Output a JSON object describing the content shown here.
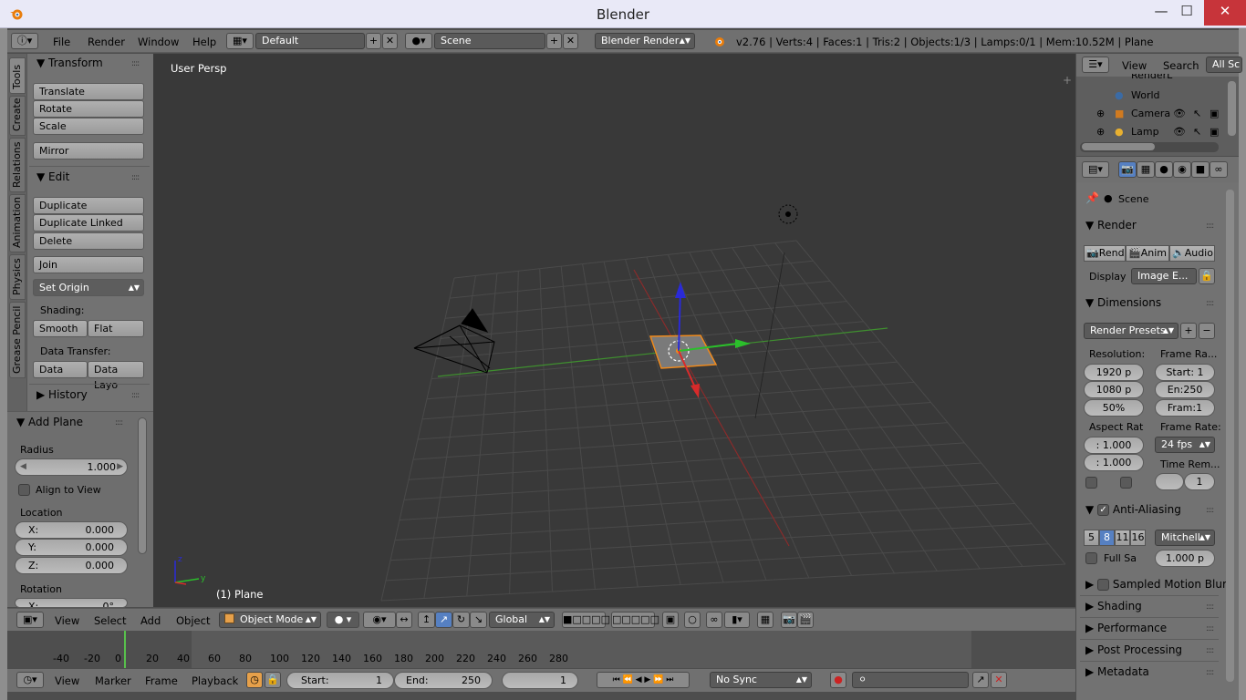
{
  "window": {
    "title": "Blender",
    "minimize": "—",
    "maximize": "☐",
    "close": "✕"
  },
  "info_bar": {
    "menus": [
      "File",
      "Render",
      "Window",
      "Help"
    ],
    "layout": "Default",
    "scene": "Scene",
    "engine": "Blender Render",
    "stats": "v2.76 | Verts:4 | Faces:1 | Tris:2 | Objects:1/3 | Lamps:0/1 | Mem:10.52M | Plane"
  },
  "toolshelf": {
    "tabs": [
      "Tools",
      "Create",
      "Relations",
      "Animation",
      "Physics",
      "Grease Pencil"
    ],
    "transform": {
      "title": "Transform",
      "buttons": [
        "Translate",
        "Rotate",
        "Scale",
        "Mirror"
      ]
    },
    "edit": {
      "title": "Edit",
      "buttons": [
        "Duplicate",
        "Duplicate Linked",
        "Delete",
        "Join"
      ],
      "set_origin": "Set Origin"
    },
    "shading": {
      "label": "Shading:",
      "smooth": "Smooth",
      "flat": "Flat"
    },
    "data_transfer": {
      "label": "Data Transfer:",
      "data": "Data",
      "data_layo": "Data Layo"
    },
    "history": "History"
  },
  "operator": {
    "title": "Add Plane",
    "radius_label": "Radius",
    "radius_value": "1.000",
    "align_label": "Align to View",
    "location_label": "Location",
    "x_label": "X:",
    "x_value": "0.000",
    "y_label": "Y:",
    "y_value": "0.000",
    "z_label": "Z:",
    "z_value": "0.000",
    "rotation_label": "Rotation",
    "rot_x_label": "X:",
    "rot_x_value": "0°"
  },
  "viewport": {
    "view_name": "User Persp",
    "object_name": "(1) Plane"
  },
  "viewport_header": {
    "menus": [
      "View",
      "Select",
      "Add",
      "Object"
    ],
    "mode": "Object Mode",
    "orientation": "Global"
  },
  "timeline": {
    "ruler": [
      "-40",
      "-20",
      "0",
      "20",
      "40",
      "60",
      "80",
      "100",
      "120",
      "140",
      "160",
      "180",
      "200",
      "220",
      "240",
      "260",
      "280"
    ],
    "current_frame_fraction": 0.0,
    "menus": [
      "View",
      "Marker",
      "Frame",
      "Playback"
    ],
    "start_label": "Start:",
    "start_value": "1",
    "end_label": "End:",
    "end_value": "250",
    "current": "1",
    "sync": "No Sync"
  },
  "outliner": {
    "menus": [
      "View",
      "Search"
    ],
    "scenes_button": "All Sc",
    "rows": [
      "RenderL",
      "World",
      "Camera",
      "Lamp"
    ]
  },
  "properties": {
    "scene": "Scene",
    "render": {
      "title": "Render",
      "rend": "Rend",
      "anim": "Anim",
      "audio": "Audio",
      "display_label": "Display",
      "display_value": "Image E..."
    },
    "dimensions": {
      "title": "Dimensions",
      "presets": "Render Presets",
      "resolution_label": "Resolution:",
      "res_x": "1920 p",
      "res_y": "1080 p",
      "res_pct": "50%",
      "frame_range_label": "Frame Ra...",
      "start": "Start: 1",
      "end": "En:250",
      "frame": "Fram:1",
      "aspect_label": "Aspect Rat",
      "aspect_x": ": 1.000",
      "aspect_y": ": 1.000",
      "frame_rate_label": "Frame Rate:",
      "fps": "24 fps",
      "time_remap_label": "Time Rem...",
      "time_remap_value": "1"
    },
    "anti_aliasing": {
      "title": "Anti-Aliasing",
      "samples": [
        "5",
        "8",
        "11",
        "16"
      ],
      "selected_sample": "8",
      "filter": "Mitchell-",
      "full_sample_label": "Full Sa",
      "filter_size": "1.000 p"
    },
    "collapsed_panels": [
      "Sampled Motion Blur",
      "Shading",
      "Performance",
      "Post Processing",
      "Metadata"
    ]
  }
}
